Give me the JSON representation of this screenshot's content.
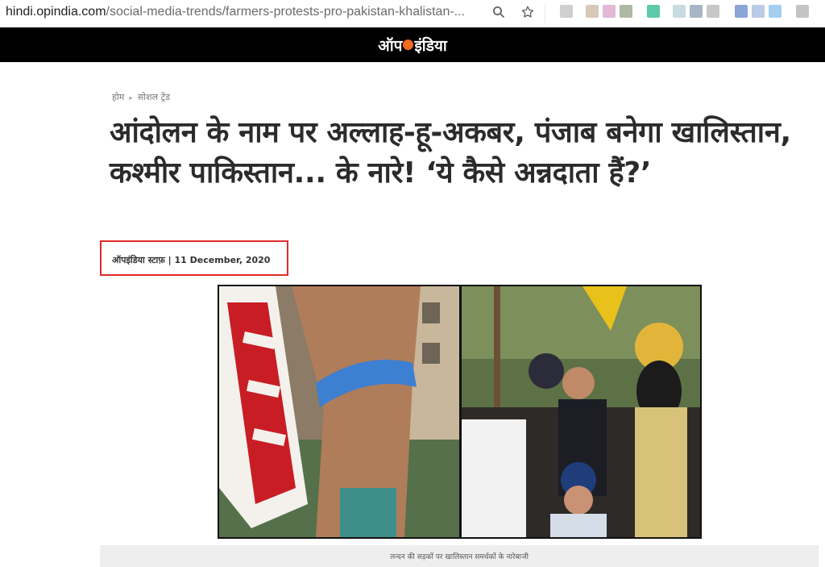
{
  "browser": {
    "url_host": "hindi.opindia.com",
    "url_path": "/social-media-trends/farmers-protests-pro-pakistan-khalistan-...",
    "icons": [
      "search-icon",
      "star-icon"
    ]
  },
  "site": {
    "logo_left": "ऑप",
    "logo_right": "इंडिया",
    "accent_color": "#f26a21"
  },
  "breadcrumb": {
    "home": "होम",
    "section": "सोशल ट्रेंड"
  },
  "article": {
    "title": "आंदोलन के नाम पर अल्लाह-हू-अकबर, पंजाब बनेगा खालिस्तान, कश्मीर पाकिस्तान... के नारे! ‘ये कैसे अन्नदाता हैं?’",
    "byline": "ऑपइंडिया स्टाफ़ | 11 December, 2020",
    "image_caption": "लन्दन की सड़कों पर खालिस्तान समर्थकों के नारेबाजी",
    "highlight_color": "#e02a2a"
  }
}
